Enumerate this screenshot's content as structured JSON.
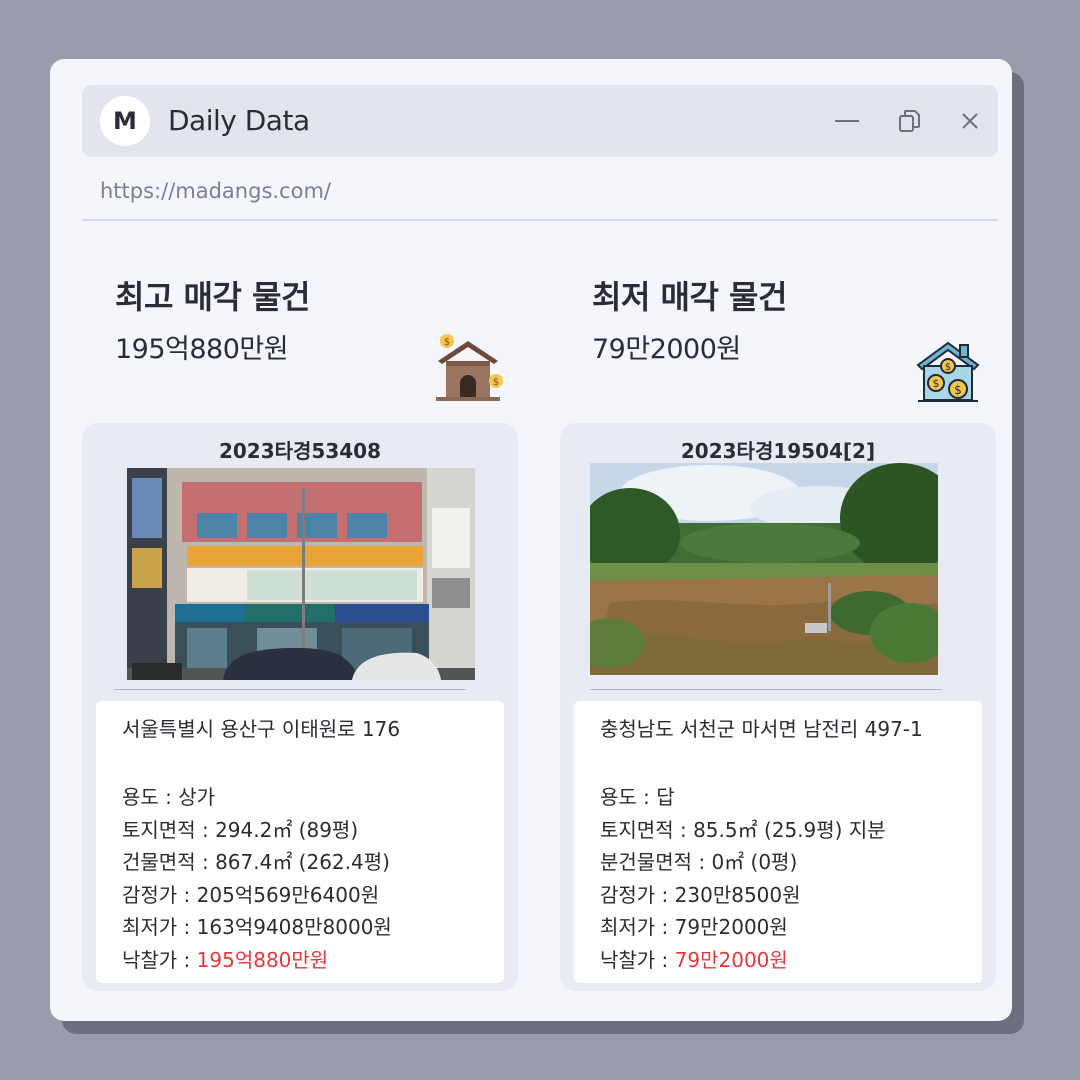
{
  "window": {
    "logo_letter": "M",
    "title": "Daily Data",
    "controls": {
      "minimize": "minimize-icon",
      "restore": "restore-icon",
      "close": "close-icon"
    },
    "url": "https://madangs.com/"
  },
  "highest": {
    "heading": "최고 매각 물건",
    "amount": "195억880만원",
    "icon": "house-money-icon",
    "case_number": "2023타경53408",
    "address": "서울특별시 용산구 이태원로 176",
    "lines": [
      {
        "label": "용도 : ",
        "value": "상가"
      },
      {
        "label": "토지면적 : ",
        "value": "294.2㎡ (89평)"
      },
      {
        "label": "건물면적 : ",
        "value": "867.4㎡ (262.4평)"
      },
      {
        "label": "감정가 : ",
        "value": "205억569만6400원"
      },
      {
        "label": "최저가 : ",
        "value": "163억9408만8000원"
      }
    ],
    "winning_label": "낙찰가 : ",
    "winning_value": "195억880만원"
  },
  "lowest": {
    "heading": "최저 매각 물건",
    "amount": "79만2000원",
    "icon": "house-coins-icon",
    "case_number": "2023타경19504[2]",
    "address": "충청남도 서천군 마서면 남전리 497-1",
    "lines": [
      {
        "label": "용도 : ",
        "value": "답"
      },
      {
        "label": "토지면적 : ",
        "value": "85.5㎡ (25.9평) 지분"
      },
      {
        "label": "분건물면적 : ",
        "value": "0㎡ (0평)"
      },
      {
        "label": "감정가 : ",
        "value": "230만8500원"
      },
      {
        "label": "최저가 : ",
        "value": "79만2000원"
      }
    ],
    "winning_label": "낙찰가 : ",
    "winning_value": "79만2000원"
  },
  "colors": {
    "accent_red": "#e6383c",
    "background": "#999cad",
    "window": "#f5f6fb"
  }
}
